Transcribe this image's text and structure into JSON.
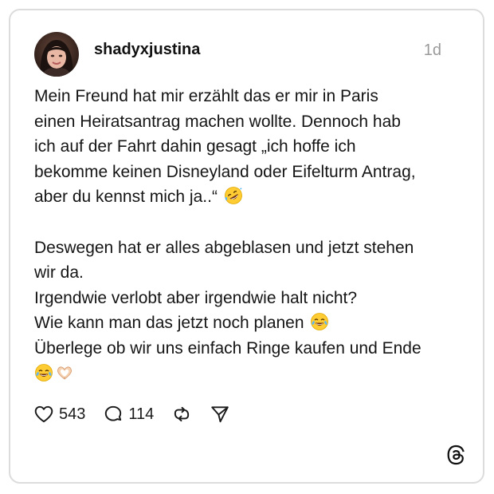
{
  "post": {
    "username": "shadyxjustina",
    "timestamp": "1d",
    "avatar_icon": "profile-photo",
    "paragraph1": {
      "line1": "Mein Freund hat mir erzählt das er mir in Paris",
      "line2": "einen Heiratsantrag machen wollte. Dennoch hab",
      "line3": "ich auf der Fahrt dahin gesagt „ich hoffe ich",
      "line4": "bekomme keinen Disneyland oder Eifelturm Antrag,",
      "line5": "aber du kennst mich ja..“"
    },
    "paragraph2": {
      "line1": "Deswegen hat er alles abgeblasen und jetzt stehen",
      "line2": "wir da.",
      "line3": "Irgendwie verlobt aber irgendwie halt nicht?",
      "line4": "Wie kann man das jetzt noch planen",
      "line5": "Überlege ob wir uns einfach Ringe kaufen und Ende"
    },
    "emojis": {
      "rofl": "rolling-on-floor-laughing-emoji",
      "joy": "tears-of-joy-emoji",
      "heart_hands": "heart-hands-emoji"
    }
  },
  "actions": {
    "likes": "543",
    "replies": "114",
    "like_icon": "heart-icon",
    "reply_icon": "speech-bubble-icon",
    "repost_icon": "repost-icon",
    "share_icon": "send-icon"
  },
  "branding": {
    "logo": "threads-logo-icon"
  },
  "colors": {
    "text": "#151515",
    "muted": "#9a9a9a",
    "border": "#dcdcdc",
    "background": "#ffffff"
  }
}
